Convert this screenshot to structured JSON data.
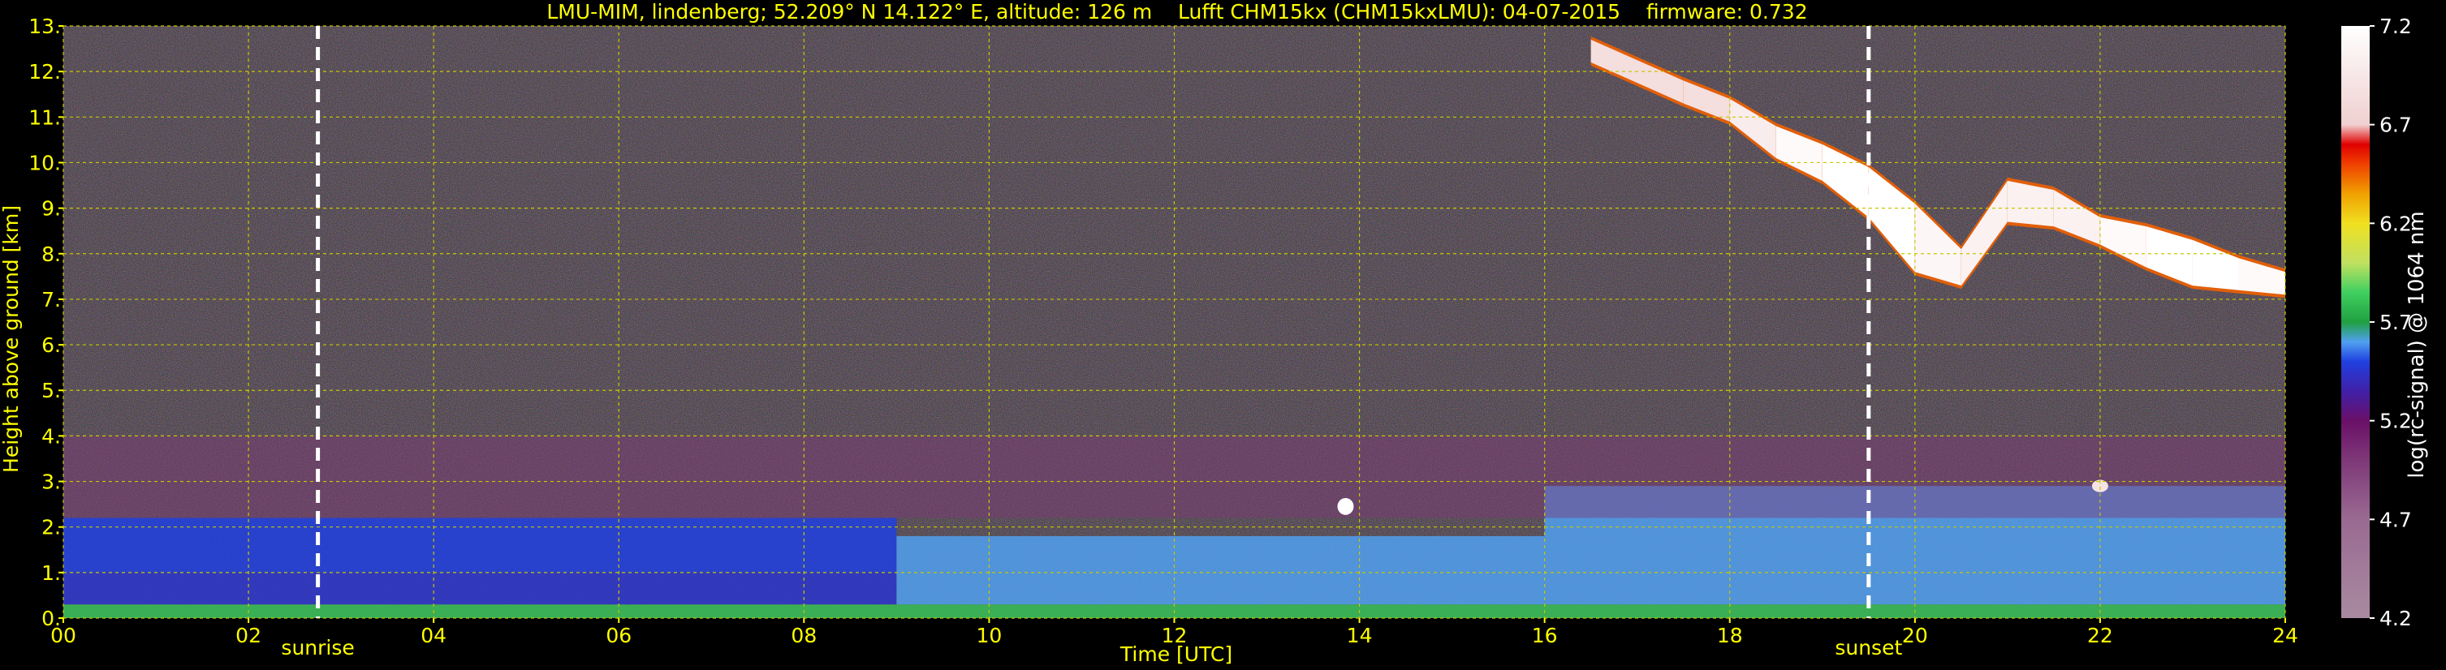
{
  "chart_data": {
    "type": "heatmap",
    "title": "LMU-MIM, lindenberg; 52.209° N 14.122° E, altitude: 126 m    Lufft CHM15kx (CHM15kxLMU): 04-07-2015    firmware: 0.732",
    "xlabel": "Time [UTC]",
    "ylabel": "Height above ground [km]",
    "colorbar_label": "log(rc-signal) @ 1064 nm",
    "xlim": [
      0,
      24
    ],
    "ylim": [
      0,
      13
    ],
    "clim": [
      4.2,
      7.2
    ],
    "grid": true,
    "x_ticks": [
      {
        "value": 0,
        "label": "00"
      },
      {
        "value": 2,
        "label": "02"
      },
      {
        "value": 4,
        "label": "04"
      },
      {
        "value": 6,
        "label": "06"
      },
      {
        "value": 8,
        "label": "08"
      },
      {
        "value": 10,
        "label": "10"
      },
      {
        "value": 12,
        "label": "12"
      },
      {
        "value": 14,
        "label": "14"
      },
      {
        "value": 16,
        "label": "16"
      },
      {
        "value": 18,
        "label": "18"
      },
      {
        "value": 20,
        "label": "20"
      },
      {
        "value": 22,
        "label": "22"
      },
      {
        "value": 24,
        "label": "24"
      }
    ],
    "y_ticks": [
      {
        "value": 0,
        "label": "0."
      },
      {
        "value": 1,
        "label": "1."
      },
      {
        "value": 2,
        "label": "2."
      },
      {
        "value": 3,
        "label": "3."
      },
      {
        "value": 4,
        "label": "4."
      },
      {
        "value": 5,
        "label": "5."
      },
      {
        "value": 6,
        "label": "6."
      },
      {
        "value": 7,
        "label": "7."
      },
      {
        "value": 8,
        "label": "8."
      },
      {
        "value": 9,
        "label": "9."
      },
      {
        "value": 10,
        "label": "10."
      },
      {
        "value": 11,
        "label": "11."
      },
      {
        "value": 12,
        "label": "12."
      },
      {
        "value": 13,
        "label": "13."
      }
    ],
    "colorbar_ticks": [
      {
        "value": 4.2,
        "label": "4.2"
      },
      {
        "value": 4.7,
        "label": "4.7"
      },
      {
        "value": 5.2,
        "label": "5.2"
      },
      {
        "value": 5.7,
        "label": "5.7"
      },
      {
        "value": 6.2,
        "label": "6.2"
      },
      {
        "value": 6.7,
        "label": "6.7"
      },
      {
        "value": 7.2,
        "label": "7.2"
      }
    ],
    "annotations": [
      {
        "name": "sunrise",
        "label": "sunrise",
        "time": 2.75
      },
      {
        "name": "sunset",
        "label": "sunset",
        "time": 19.5
      }
    ],
    "colormap": [
      {
        "value": 4.2,
        "color": "#a88aa0"
      },
      {
        "value": 4.7,
        "color": "#9a6a92"
      },
      {
        "value": 5.0,
        "color": "#7e3878"
      },
      {
        "value": 5.2,
        "color": "#6a1068"
      },
      {
        "value": 5.35,
        "color": "#4020a8"
      },
      {
        "value": 5.5,
        "color": "#2040e0"
      },
      {
        "value": 5.6,
        "color": "#50a0f0"
      },
      {
        "value": 5.7,
        "color": "#20a040"
      },
      {
        "value": 5.85,
        "color": "#40d060"
      },
      {
        "value": 6.0,
        "color": "#c0e060"
      },
      {
        "value": 6.2,
        "color": "#f0e020"
      },
      {
        "value": 6.35,
        "color": "#f0a000"
      },
      {
        "value": 6.5,
        "color": "#f04000"
      },
      {
        "value": 6.6,
        "color": "#e00000"
      },
      {
        "value": 6.7,
        "color": "#f0d0d0"
      },
      {
        "value": 7.2,
        "color": "#ffffff"
      }
    ],
    "layers": [
      {
        "feature": "near-surface aerosol",
        "t_start": 0,
        "t_end": 24,
        "z_bottom": 0,
        "z_top": 0.3,
        "value": 5.8
      },
      {
        "feature": "boundary layer",
        "t_start": 0,
        "t_end": 9,
        "z_bottom": 0.3,
        "z_top": 1.0,
        "value": 5.45
      },
      {
        "feature": "residual layer",
        "t_start": 0,
        "t_end": 9,
        "z_bottom": 1.0,
        "z_top": 2.2,
        "value": 5.5
      },
      {
        "feature": "mixed layer",
        "t_start": 9,
        "t_end": 16,
        "z_bottom": 0.3,
        "z_top": 1.8,
        "value": 5.6
      },
      {
        "feature": "mixed layer",
        "t_start": 16,
        "t_end": 24,
        "z_bottom": 0.3,
        "z_top": 2.9,
        "value": 5.6
      },
      {
        "feature": "upper aerosol layer",
        "t_start": 0,
        "t_end": 24,
        "z_bottom": 2.2,
        "z_top": 4.0,
        "value": 5.0
      }
    ],
    "cirrus_cloud": [
      {
        "time": 16.5,
        "base": 12.2,
        "top": 12.7,
        "value": 6.9
      },
      {
        "time": 17.5,
        "base": 11.3,
        "top": 11.8,
        "value": 6.8
      },
      {
        "time": 18.0,
        "base": 10.9,
        "top": 11.4,
        "value": 6.9
      },
      {
        "time": 18.5,
        "base": 10.1,
        "top": 10.8,
        "value": 7.1
      },
      {
        "time": 19.0,
        "base": 9.6,
        "top": 10.4,
        "value": 7.2
      },
      {
        "time": 19.5,
        "base": 8.8,
        "top": 9.9,
        "value": 7.2
      },
      {
        "time": 20.0,
        "base": 7.6,
        "top": 9.1,
        "value": 7.2
      },
      {
        "time": 20.5,
        "base": 7.3,
        "top": 8.1,
        "value": 7.0
      },
      {
        "time": 21.0,
        "base": 8.7,
        "top": 9.6,
        "value": 7.1
      },
      {
        "time": 21.5,
        "base": 8.6,
        "top": 9.4,
        "value": 7.0
      },
      {
        "time": 22.0,
        "base": 8.2,
        "top": 8.8,
        "value": 7.1
      },
      {
        "time": 22.5,
        "base": 7.7,
        "top": 8.6,
        "value": 7.2
      },
      {
        "time": 23.0,
        "base": 7.3,
        "top": 8.3,
        "value": 7.2
      },
      {
        "time": 23.5,
        "base": 7.2,
        "top": 7.9,
        "value": 7.2
      },
      {
        "time": 24.0,
        "base": 7.1,
        "top": 7.6,
        "value": 7.1
      }
    ],
    "low_clouds": [
      {
        "time": 13.85,
        "base": 2.3,
        "top": 2.6,
        "value": 7.2
      },
      {
        "time": 22.0,
        "base": 2.8,
        "top": 3.0,
        "value": 6.9
      }
    ],
    "colors": {
      "text": "#ffff00",
      "grid": "#c8c800",
      "marker": "#ffffff",
      "colorbar_label": "#ffffff",
      "noise_background": "#3a2a3a"
    }
  }
}
